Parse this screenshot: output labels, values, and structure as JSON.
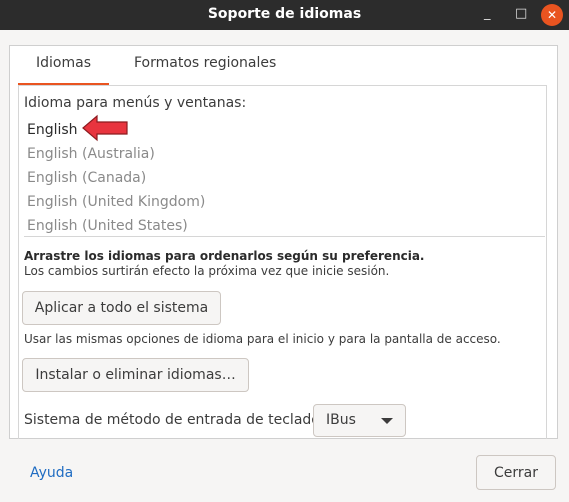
{
  "window": {
    "title": "Soporte de idiomas",
    "minimize": "_",
    "maximize": "□",
    "close": "✕"
  },
  "tabs": [
    {
      "label": "Idiomas"
    },
    {
      "label": "Formatos regionales"
    }
  ],
  "languages_section": {
    "heading": "Idioma para menús y ventanas:",
    "items": [
      "English",
      "English (Australia)",
      "English (Canada)",
      "English (United Kingdom)",
      "English (United States)"
    ]
  },
  "hint": {
    "bold": "Arrastre los idiomas para ordenarlos según su preferencia.",
    "normal": "Los cambios surtirán efecto la próxima vez que inicie sesión."
  },
  "buttons": {
    "apply_all": "Aplicar a todo el sistema",
    "apply_desc": "Usar las mismas opciones de idioma para el inicio y para la pantalla de acceso.",
    "install_remove": "Instalar o eliminar idiomas…"
  },
  "input_method": {
    "label": "Sistema de método de entrada de teclado:",
    "selected": "IBus"
  },
  "footer": {
    "help": "Ayuda",
    "close": "Cerrar"
  },
  "colors": {
    "accent": "#e95420",
    "arrow": "#e8343e",
    "link": "#1f6cc2"
  }
}
